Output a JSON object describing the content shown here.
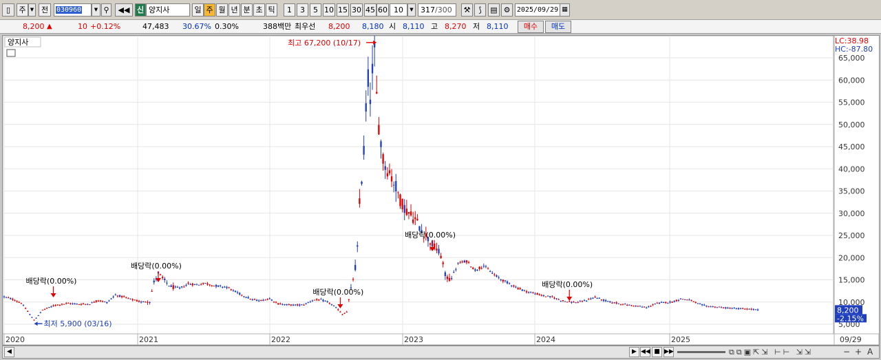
{
  "toolbar": {
    "period_type": "주",
    "prev_label": "전",
    "stock_code": "030960",
    "new_badge": "신",
    "stock_name": "양지사",
    "periods": [
      "일",
      "주",
      "월",
      "년",
      "분",
      "초",
      "틱"
    ],
    "selected_period": "주",
    "intervals": [
      "1",
      "3",
      "5",
      "10",
      "15",
      "30",
      "45",
      "60"
    ],
    "interval_value": "10",
    "count_value": "317",
    "count_total": "/300",
    "date": "2025/09/29"
  },
  "quote": {
    "price": "8,200",
    "change_arrow": "▲",
    "change": "10",
    "change_pct": "+0.12%",
    "volume": "47,483",
    "turnover_pct": "30.67%",
    "volume_pct": "0.30%",
    "amount": "388백만",
    "best_bid_label": "최우선",
    "best_ask": "8,200",
    "best_bid": "8,180",
    "open_label": "시",
    "open": "8,110",
    "high_label": "고",
    "high": "8,270",
    "low_label": "저",
    "low": "8,110",
    "buy_label": "매수",
    "sell_label": "매도"
  },
  "chart_data": {
    "type": "candlestick",
    "title": "양지사",
    "ylim": [
      5000,
      67000
    ],
    "yticks": [
      5000,
      10000,
      15000,
      20000,
      25000,
      30000,
      35000,
      40000,
      45000,
      50000,
      55000,
      60000,
      65000
    ],
    "ytick_labels": [
      "5,000",
      "10,000",
      "15,000",
      "20,000",
      "25,000",
      "30,000",
      "35,000",
      "40,000",
      "45,000",
      "50,000",
      "55,000",
      "60,000",
      "65,000"
    ],
    "xtick_labels": [
      "2020",
      "2021",
      "2022",
      "2023",
      "2024",
      "2025",
      "09/29"
    ],
    "lc_label": "LC:38.98",
    "hc_label": "HC:-87.80",
    "last_price_label": "8,200",
    "last_change_label": "-2.15%",
    "annotations": {
      "high": "최고 67,200 (10/17)",
      "low": "최저 5,900 (03/16)",
      "dividends": [
        "배당락(0.00%)",
        "배당락(0.00%)",
        "배당락(0.00%)",
        "배당락(0.00%)",
        "배당락(0.00%)"
      ]
    },
    "up_color": "#e00000",
    "down_color": "#1f3fbf",
    "price_path": [
      [
        0,
        11200
      ],
      [
        4,
        10600
      ],
      [
        8,
        9800
      ],
      [
        12,
        7200
      ],
      [
        14,
        5900
      ],
      [
        18,
        8200
      ],
      [
        24,
        9300
      ],
      [
        30,
        9700
      ],
      [
        36,
        9500
      ],
      [
        40,
        9600
      ],
      [
        44,
        10400
      ],
      [
        48,
        9900
      ],
      [
        52,
        11600
      ],
      [
        56,
        11100
      ],
      [
        60,
        10500
      ],
      [
        64,
        10000
      ],
      [
        68,
        10200
      ],
      [
        70,
        14500
      ],
      [
        72,
        16500
      ],
      [
        74,
        15200
      ],
      [
        78,
        13400
      ],
      [
        82,
        13100
      ],
      [
        86,
        14100
      ],
      [
        90,
        13900
      ],
      [
        94,
        14200
      ],
      [
        98,
        13700
      ],
      [
        104,
        13400
      ],
      [
        108,
        12300
      ],
      [
        112,
        11400
      ],
      [
        116,
        10500
      ],
      [
        120,
        10300
      ],
      [
        124,
        10800
      ],
      [
        128,
        9600
      ],
      [
        132,
        9400
      ],
      [
        136,
        9300
      ],
      [
        140,
        9400
      ],
      [
        144,
        10400
      ],
      [
        148,
        10500
      ],
      [
        152,
        9800
      ],
      [
        156,
        8300
      ],
      [
        158,
        7200
      ],
      [
        160,
        7800
      ],
      [
        162,
        12800
      ],
      [
        164,
        17800
      ],
      [
        165,
        22000
      ],
      [
        166,
        32000
      ],
      [
        167,
        38000
      ],
      [
        168,
        44000
      ],
      [
        169,
        54000
      ],
      [
        170,
        60000
      ],
      [
        171,
        57000
      ],
      [
        172,
        62000
      ],
      [
        173,
        66000
      ],
      [
        174,
        56000
      ],
      [
        175,
        50000
      ],
      [
        176,
        46000
      ],
      [
        177,
        42000
      ],
      [
        179,
        40000
      ],
      [
        181,
        38000
      ],
      [
        183,
        36000
      ],
      [
        185,
        33000
      ],
      [
        188,
        30500
      ],
      [
        192,
        28500
      ],
      [
        196,
        25500
      ],
      [
        200,
        23000
      ],
      [
        204,
        20500
      ],
      [
        206,
        16000
      ],
      [
        208,
        15200
      ],
      [
        210,
        16500
      ],
      [
        212,
        18600
      ],
      [
        216,
        19200
      ],
      [
        220,
        17200
      ],
      [
        224,
        18200
      ],
      [
        228,
        16500
      ],
      [
        232,
        15100
      ],
      [
        236,
        14200
      ],
      [
        240,
        13100
      ],
      [
        244,
        12400
      ],
      [
        248,
        11900
      ],
      [
        252,
        11400
      ],
      [
        256,
        11100
      ],
      [
        260,
        10400
      ],
      [
        264,
        10000
      ],
      [
        268,
        9900
      ],
      [
        272,
        10400
      ],
      [
        276,
        11100
      ],
      [
        280,
        10400
      ],
      [
        284,
        9900
      ],
      [
        288,
        9600
      ],
      [
        292,
        9300
      ],
      [
        296,
        9100
      ],
      [
        300,
        8700
      ],
      [
        304,
        9600
      ],
      [
        308,
        9900
      ],
      [
        312,
        10000
      ],
      [
        316,
        10700
      ],
      [
        320,
        10500
      ],
      [
        324,
        9600
      ],
      [
        328,
        9100
      ],
      [
        332,
        8900
      ],
      [
        336,
        8700
      ],
      [
        340,
        8600
      ],
      [
        344,
        8500
      ],
      [
        348,
        8400
      ],
      [
        350,
        8300
      ],
      [
        352,
        8200
      ]
    ]
  },
  "scrollbar": {
    "zoom_minus": "−",
    "zoom_plus": "+",
    "font_label": "A"
  }
}
